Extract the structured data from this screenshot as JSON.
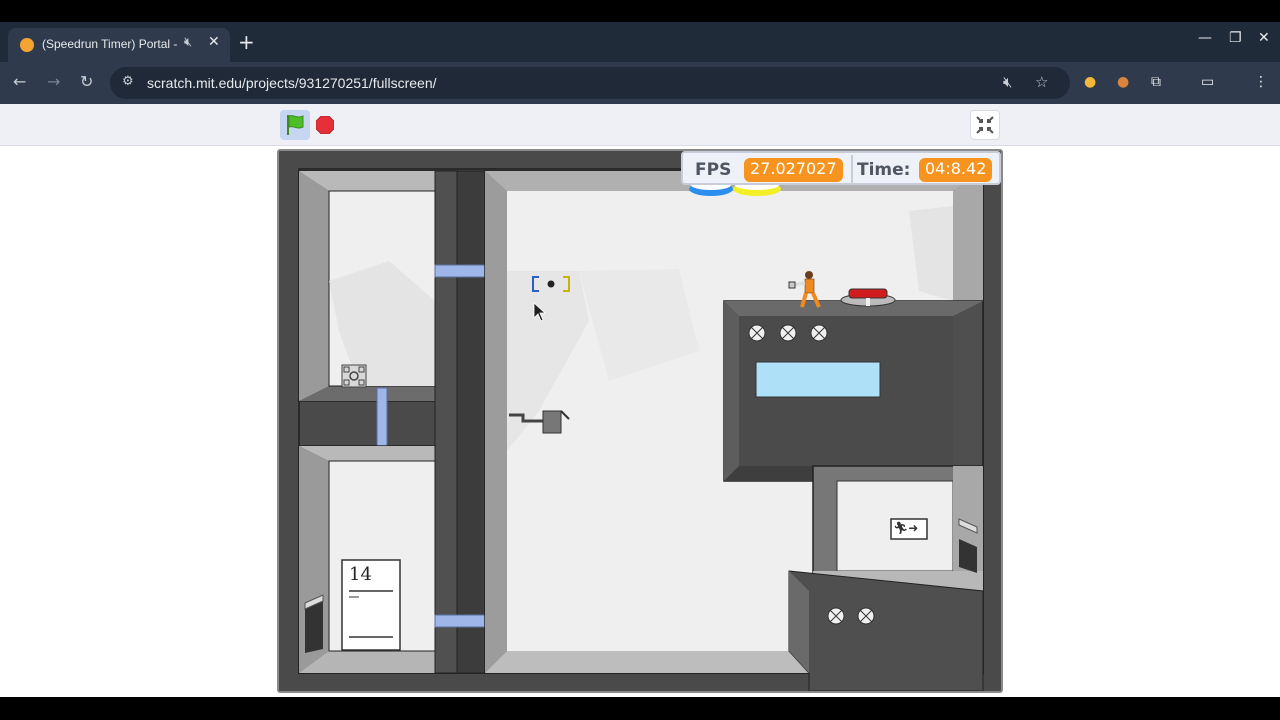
{
  "browser": {
    "tab_title": "(Speedrun Timer) Portal - T",
    "new_tab": "+",
    "url": "scratch.mit.edu/projects/931270251/fullscreen/"
  },
  "hud": {
    "fps_label": "FPS",
    "fps_value": "27.027027",
    "time_label": "Time:",
    "time_value": "04:8.42"
  },
  "level": {
    "sign_number": "14"
  },
  "colors": {
    "portal_blue": "#2c8ff0",
    "portal_yellow": "#f3ef27",
    "hud_orange": "#f6941f",
    "button_red": "#d01c1c",
    "glass": "#aee0f7"
  }
}
